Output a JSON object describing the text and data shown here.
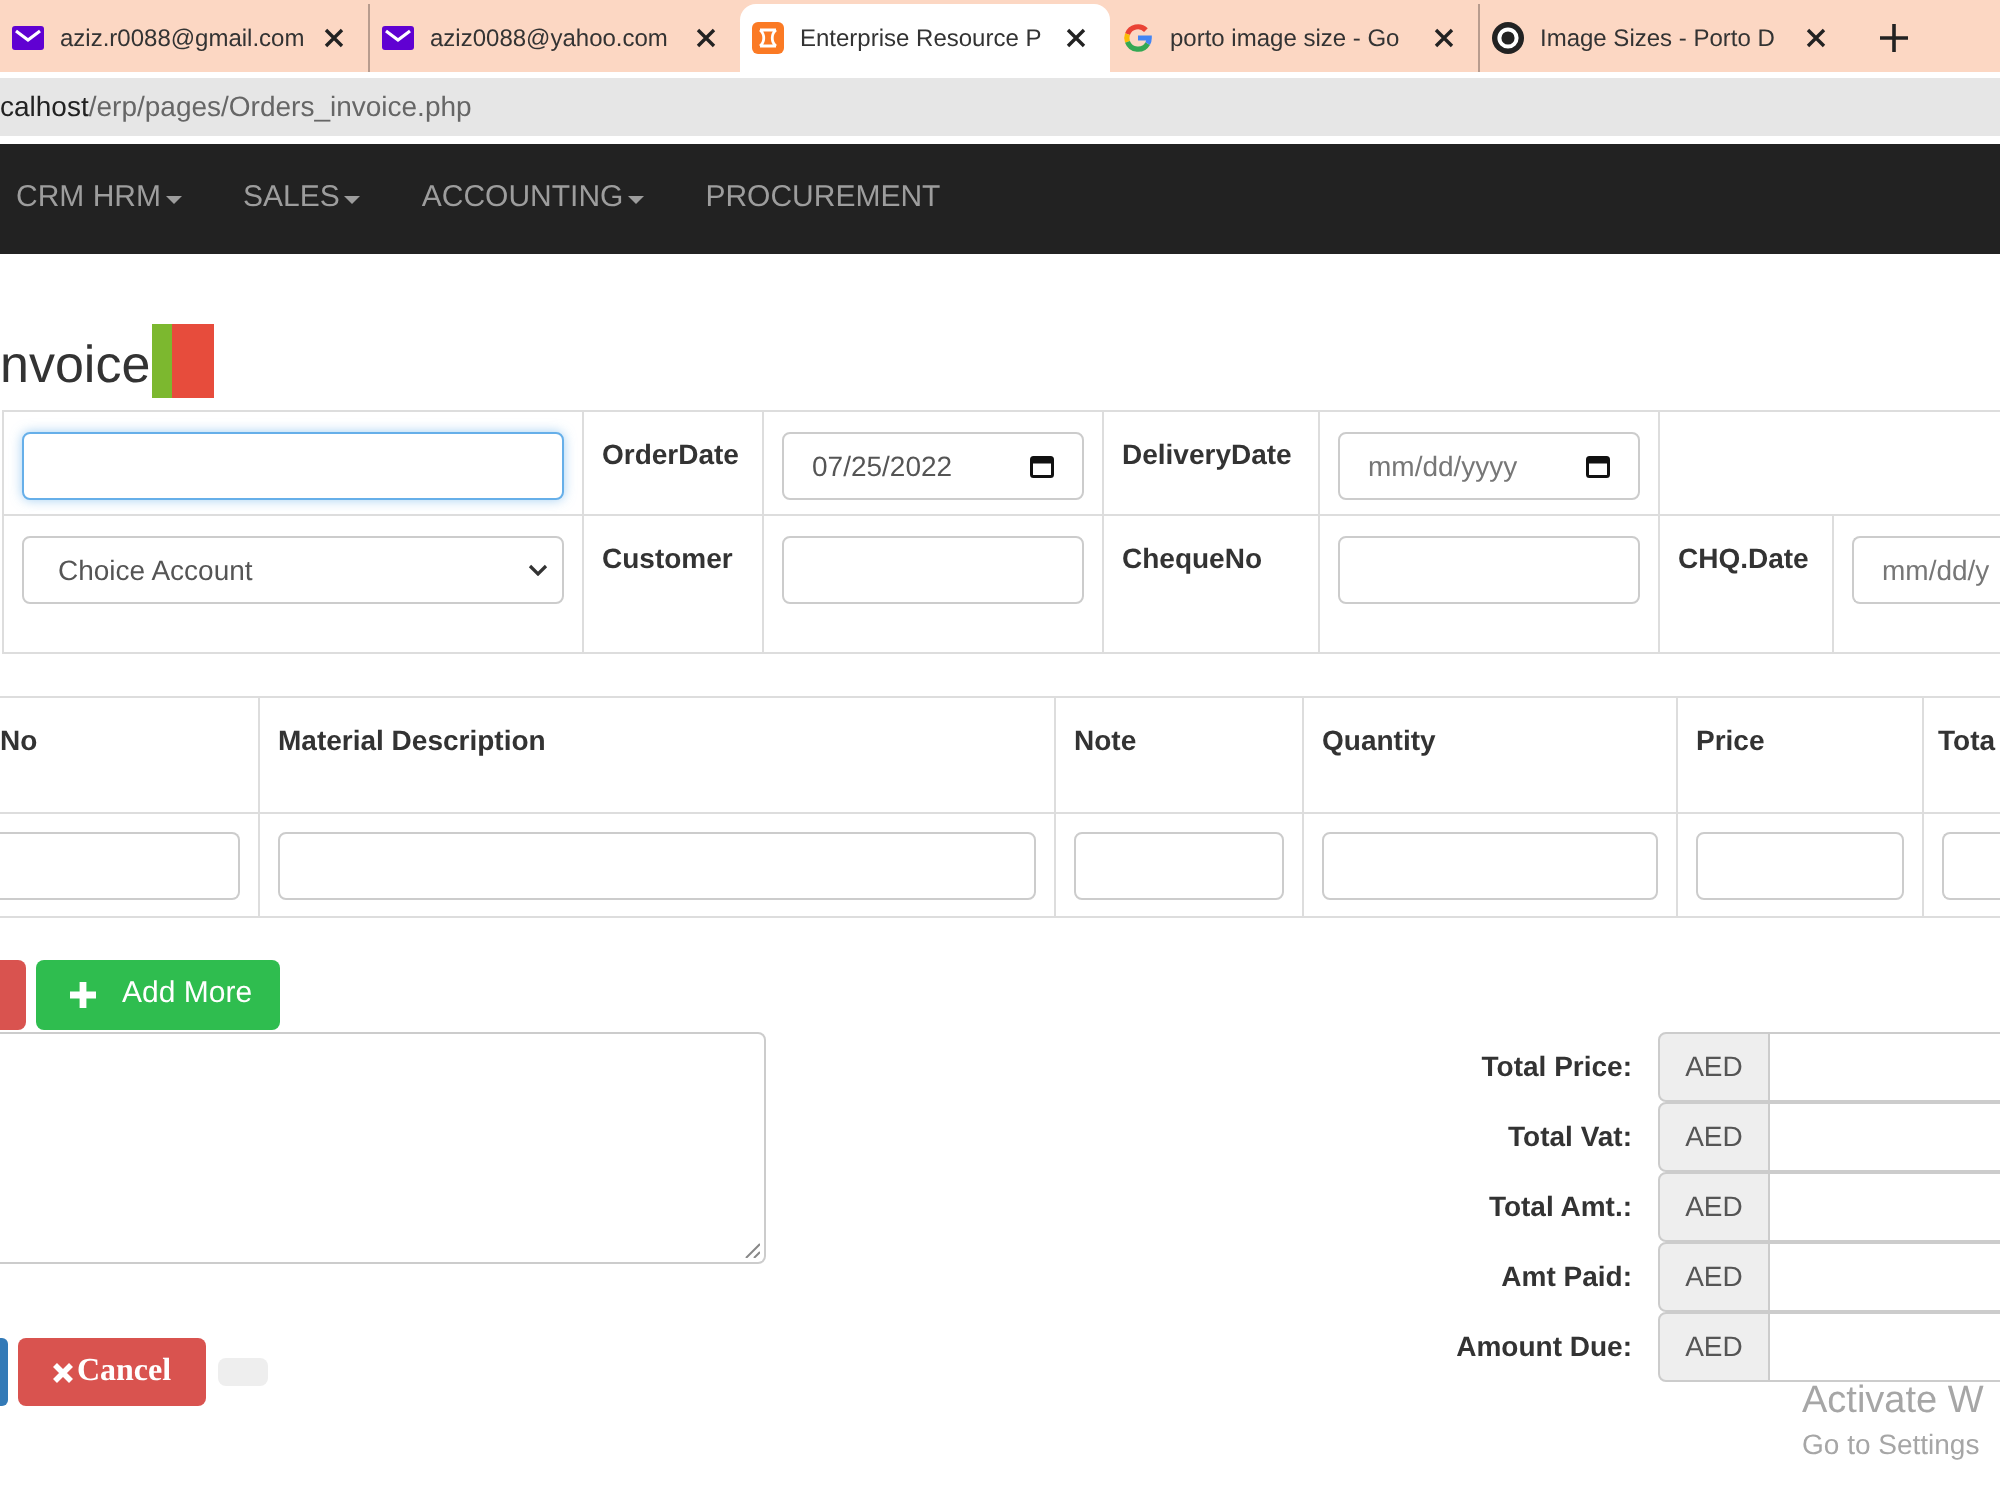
{
  "browser": {
    "tabs": [
      {
        "kind": "mail",
        "title": "aziz.r0088@gmail.com",
        "selected": false
      },
      {
        "kind": "mail",
        "title": "aziz0088@yahoo.com",
        "selected": false
      },
      {
        "kind": "logo",
        "title": "Enterprise Resource P",
        "selected": true
      },
      {
        "kind": "g",
        "title": "porto image size - Go",
        "selected": false
      },
      {
        "kind": "ring",
        "title": "Image Sizes - Porto D",
        "selected": false
      }
    ],
    "address_bar": {
      "host": "calhost",
      "path": "/erp/pages/Orders_invoice.php"
    }
  },
  "navbar": {
    "items": [
      {
        "label": "CRM HRM",
        "dropdown": true
      },
      {
        "label": "SALES",
        "dropdown": true
      },
      {
        "label": "ACCOUNTING",
        "dropdown": true
      },
      {
        "label": "PROCUREMENT",
        "dropdown": false
      }
    ]
  },
  "page_title": "nvoice",
  "header_form": {
    "rows": [
      {
        "cells": [
          {
            "kind": "input",
            "focused": true
          },
          {
            "kind": "label",
            "text": "OrderDate"
          },
          {
            "kind": "date",
            "value": "07/25/2022",
            "focused": false
          },
          {
            "kind": "label",
            "text": "DeliveryDate"
          },
          {
            "kind": "date",
            "placeholder": "mm/dd/yyyy",
            "focused": false
          },
          {
            "kind": "blank"
          }
        ]
      },
      {
        "cells": [
          {
            "kind": "select",
            "value": "Choice Account",
            "focused": false
          },
          {
            "kind": "label",
            "text": "Customer"
          },
          {
            "kind": "input",
            "focused": false
          },
          {
            "kind": "label",
            "text": "ChequeNo"
          },
          {
            "kind": "input",
            "focused": false
          },
          {
            "kind": "label",
            "text": "CHQ.Date"
          },
          {
            "kind": "date",
            "placeholder": "mm/dd/y",
            "focused": false
          }
        ]
      }
    ]
  },
  "items_table": {
    "columns": [
      "No",
      "Material Description",
      "Note",
      "Quantity",
      "Price",
      "Tota"
    ],
    "rows": [
      {
        "cells": [
          {
            "kind": "input"
          },
          {
            "kind": "input"
          },
          {
            "kind": "input"
          },
          {
            "kind": "input"
          },
          {
            "kind": "input"
          },
          {
            "kind": "input"
          }
        ]
      }
    ]
  },
  "row_buttons": [
    {
      "kind": "danger_cut"
    },
    {
      "kind": "success",
      "label": "Add More"
    }
  ],
  "footer_buttons": [
    {
      "kind": "primary_cut"
    },
    {
      "kind": "cancel",
      "label": "Cancel"
    },
    {
      "kind": "blank"
    }
  ],
  "totals": [
    {
      "label": "Total Price:",
      "addon": "AED"
    },
    {
      "label": "Total Vat:",
      "addon": "AED"
    },
    {
      "label": "Total Amt.:",
      "addon": "AED"
    },
    {
      "label": "Amt Paid:",
      "addon": "AED"
    },
    {
      "label": "Amount Due:",
      "addon": "AED"
    }
  ],
  "os_notice": {
    "title": "Activate W",
    "subtitle": "Go to Settings"
  }
}
